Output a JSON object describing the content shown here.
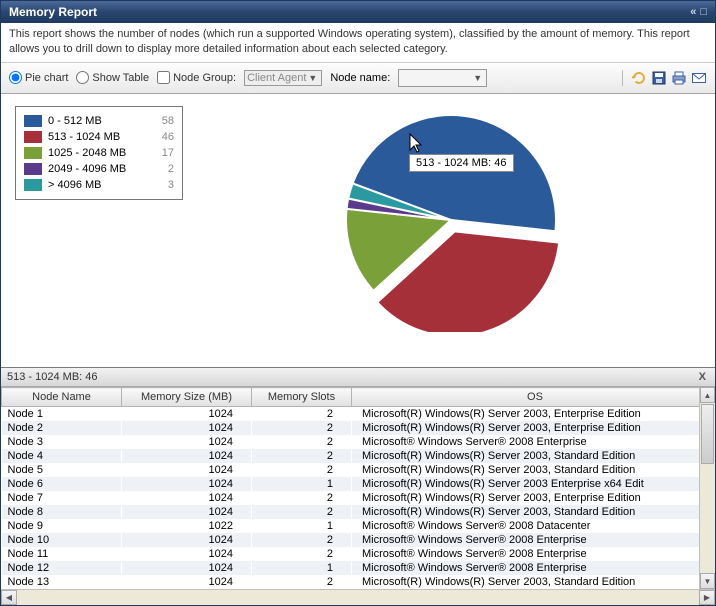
{
  "title": "Memory Report",
  "description": "This report shows the number of nodes (which run a supported Windows operating system), classified by the amount of memory. This report allows you to drill down to display more detailed information about each selected category.",
  "toolbar": {
    "pie_label": "Pie chart",
    "table_label": "Show Table",
    "nodegroup_label": "Node Group:",
    "nodegroup_value": "Client Agent",
    "nodename_label": "Node name:",
    "nodename_value": ""
  },
  "tooltip": "513 - 1024 MB: 46",
  "chart_data": {
    "type": "pie",
    "title": "",
    "series": [
      {
        "name": "0 - 512 MB",
        "value": 58,
        "color": "#2a5a9a"
      },
      {
        "name": "513 - 1024 MB",
        "value": 46,
        "color": "#a63039"
      },
      {
        "name": "1025 - 2048 MB",
        "value": 17,
        "color": "#7aa03a"
      },
      {
        "name": "2049 - 4096 MB",
        "value": 2,
        "color": "#5a3a8a"
      },
      {
        "name": "> 4096 MB",
        "value": 3,
        "color": "#2a9aa0"
      }
    ],
    "exploded_index": 1
  },
  "lower_header": "513 - 1024 MB: 46",
  "table": {
    "columns": [
      "Node Name",
      "Memory Size (MB)",
      "Memory Slots",
      "OS"
    ],
    "rows": [
      {
        "name": "Node 1",
        "mem": "1024",
        "slots": "2",
        "os": "Microsoft(R) Windows(R) Server 2003, Enterprise Edition"
      },
      {
        "name": "Node 2",
        "mem": "1024",
        "slots": "2",
        "os": "Microsoft(R) Windows(R) Server 2003, Enterprise Edition"
      },
      {
        "name": "Node 3",
        "mem": "1024",
        "slots": "2",
        "os": "Microsoft® Windows Server® 2008 Enterprise"
      },
      {
        "name": "Node 4",
        "mem": "1024",
        "slots": "2",
        "os": "Microsoft(R) Windows(R) Server 2003, Standard Edition"
      },
      {
        "name": "Node 5",
        "mem": "1024",
        "slots": "2",
        "os": "Microsoft(R) Windows(R) Server 2003, Standard Edition"
      },
      {
        "name": "Node 6",
        "mem": "1024",
        "slots": "1",
        "os": "Microsoft(R) Windows(R) Server 2003 Enterprise x64 Edit"
      },
      {
        "name": "Node 7",
        "mem": "1024",
        "slots": "2",
        "os": "Microsoft(R) Windows(R) Server 2003, Enterprise Edition"
      },
      {
        "name": "Node 8",
        "mem": "1024",
        "slots": "2",
        "os": "Microsoft(R) Windows(R) Server 2003, Standard Edition"
      },
      {
        "name": "Node 9",
        "mem": "1022",
        "slots": "1",
        "os": "Microsoft® Windows Server® 2008 Datacenter"
      },
      {
        "name": "Node 10",
        "mem": "1024",
        "slots": "2",
        "os": "Microsoft® Windows Server® 2008 Enterprise"
      },
      {
        "name": "Node 11",
        "mem": "1024",
        "slots": "2",
        "os": "Microsoft® Windows Server® 2008 Enterprise"
      },
      {
        "name": "Node 12",
        "mem": "1024",
        "slots": "1",
        "os": "Microsoft® Windows Server® 2008 Enterprise"
      },
      {
        "name": "Node 13",
        "mem": "1024",
        "slots": "2",
        "os": "Microsoft(R) Windows(R) Server 2003, Standard Edition"
      }
    ]
  }
}
